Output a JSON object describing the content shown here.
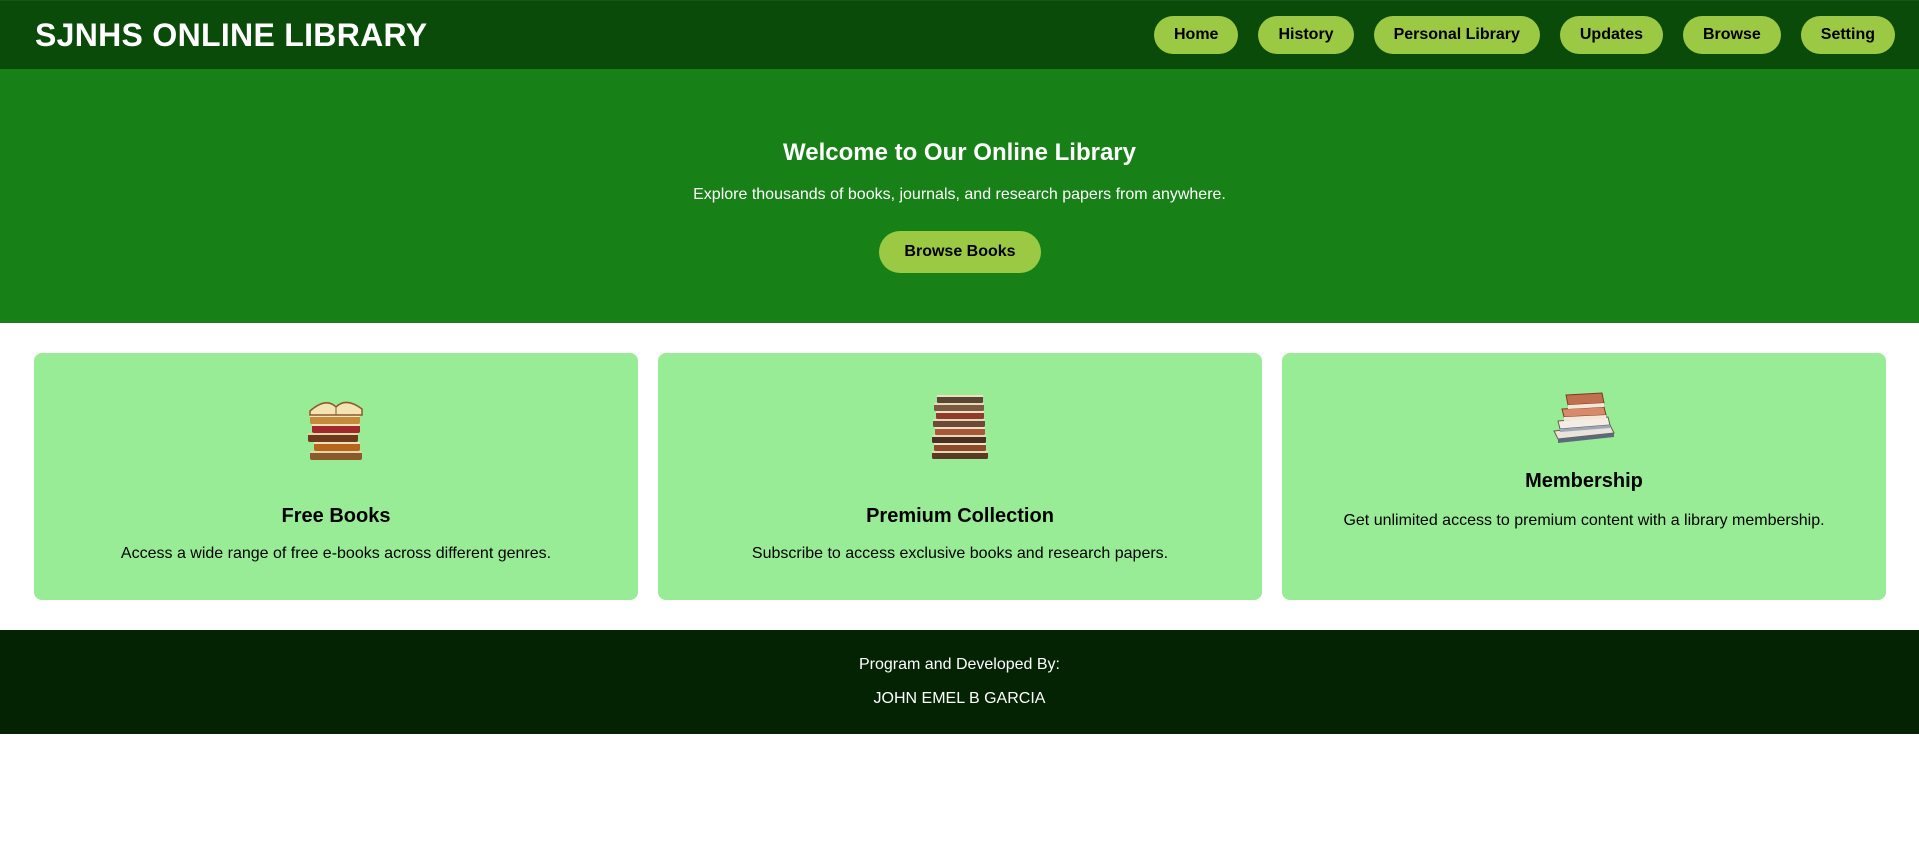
{
  "header": {
    "logo": "SJNHS ONLINE LIBRARY",
    "nav": [
      "Home",
      "History",
      "Personal Library",
      "Updates",
      "Browse",
      "Setting"
    ]
  },
  "hero": {
    "title": "Welcome to Our Online Library",
    "subtitle": "Explore thousands of books, journals, and research papers from anywhere.",
    "button": "Browse Books"
  },
  "cards": [
    {
      "title": "Free Books",
      "description": "Access a wide range of free e-books across different genres.",
      "icon": "book-stack-icon"
    },
    {
      "title": "Premium Collection",
      "description": "Subscribe to access exclusive books and research papers.",
      "icon": "book-stack-icon"
    },
    {
      "title": "Membership",
      "description": "Get unlimited access to premium content with a library membership.",
      "icon": "book-stack-icon"
    }
  ],
  "footer": {
    "line1": "Program and Developed By:",
    "line2": "JOHN EMEL B GARCIA"
  },
  "colors": {
    "header_bg": "#0a4b0a",
    "hero_bg": "#178117",
    "button_bg": "#9bc943",
    "card_bg": "#98ec96",
    "footer_bg": "#032303"
  }
}
